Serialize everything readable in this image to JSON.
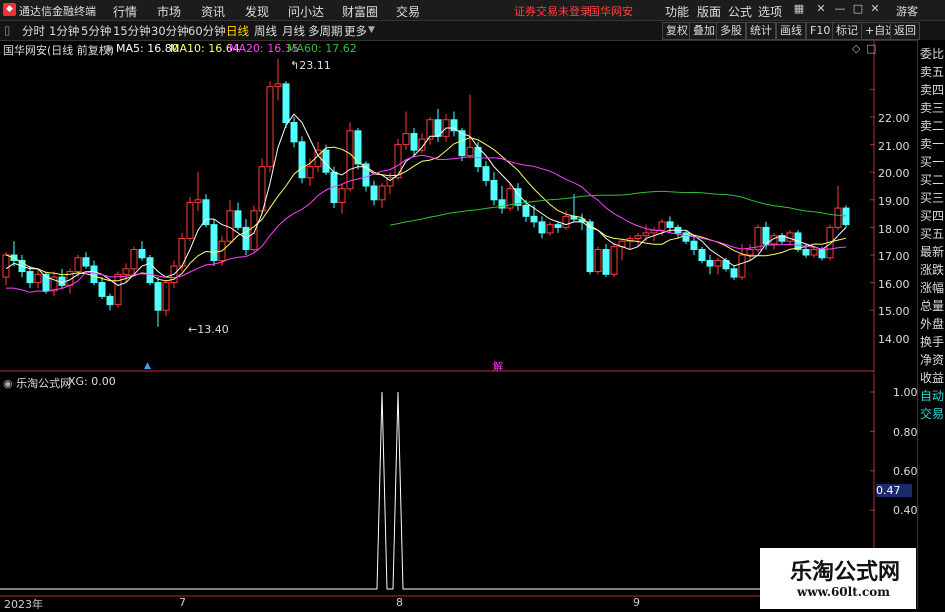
{
  "app": {
    "title": "通达信金融终端",
    "menus": [
      "行情",
      "市场",
      "资讯",
      "发现",
      "问小达",
      "财富圈",
      "交易"
    ],
    "login_status": "证券交易未登录",
    "stock_name": "国华网安",
    "right_menus": [
      "功能",
      "版面",
      "公式",
      "选项"
    ],
    "guest": "游客"
  },
  "toolbar": {
    "periods": [
      "分时",
      "1分钟",
      "5分钟",
      "15分钟",
      "30分钟",
      "60分钟",
      "日线",
      "周线",
      "月线",
      "多周期",
      "更多"
    ],
    "active": "日线",
    "right_buttons": [
      "复权",
      "叠加",
      "多股",
      "统计",
      "画线",
      "F10",
      "标记",
      "+自选",
      "返回"
    ]
  },
  "main_legend": {
    "title": "国华网安(日线 前复权)",
    "ma5": "MA5: 16.80",
    "ma10": "MA10: 16.64",
    "ma20": "MA20: 16.35",
    "ma60": "MA60: 17.62",
    "high_label": "23.11",
    "low_label": "13.40",
    "jie_marker": "解"
  },
  "sub_legend": {
    "title": "乐淘公式网",
    "xg": "XG: 0.00",
    "current": "0.47"
  },
  "price_axis": [
    "22.00",
    "21.00",
    "20.00",
    "19.00",
    "18.00",
    "17.00",
    "16.00",
    "15.00",
    "14.00"
  ],
  "indicator_axis": [
    "1.00",
    "0.80",
    "0.60",
    "0.40"
  ],
  "x_labels": [
    "2023年",
    "7",
    "8",
    "9"
  ],
  "sidebar": [
    "委比",
    "卖五",
    "卖四",
    "卖三",
    "卖二",
    "卖一",
    "买一",
    "买二",
    "买三",
    "买四",
    "买五",
    "最新",
    "涨跌",
    "涨幅",
    "总量",
    "外盘",
    "换手",
    "净资",
    "收益",
    "自动",
    "交易"
  ],
  "watermark": {
    "title": "乐淘公式网",
    "url": "www.60lt.com"
  },
  "colors": {
    "up": "#ff3b3b",
    "down": "#54ffff",
    "ma5": "#ffffff",
    "ma10": "#ffff66",
    "ma20": "#ff40ff",
    "ma60": "#30c030",
    "menu_red": "#ff4040"
  },
  "chart_data": {
    "type": "candlestick",
    "ylim": [
      13.0,
      23.5
    ],
    "candles": [
      [
        15.2,
        16.1,
        14.9,
        16.0
      ],
      [
        16.0,
        16.5,
        15.6,
        15.8
      ],
      [
        15.8,
        16.0,
        15.2,
        15.4
      ],
      [
        15.4,
        15.6,
        14.8,
        15.0
      ],
      [
        15.0,
        15.5,
        14.8,
        15.3
      ],
      [
        15.3,
        15.4,
        14.6,
        14.7
      ],
      [
        14.7,
        15.4,
        14.5,
        15.2
      ],
      [
        15.2,
        15.5,
        14.8,
        14.9
      ],
      [
        14.9,
        15.5,
        14.6,
        15.4
      ],
      [
        15.4,
        16.0,
        15.2,
        15.9
      ],
      [
        15.9,
        16.1,
        15.5,
        15.6
      ],
      [
        15.6,
        15.8,
        14.9,
        15.0
      ],
      [
        15.0,
        15.2,
        14.4,
        14.5
      ],
      [
        14.5,
        14.6,
        14.0,
        14.2
      ],
      [
        14.2,
        15.4,
        14.1,
        15.3
      ],
      [
        15.3,
        15.7,
        15.0,
        15.5
      ],
      [
        15.5,
        16.3,
        15.3,
        16.2
      ],
      [
        16.2,
        16.5,
        15.8,
        15.9
      ],
      [
        15.9,
        16.0,
        14.9,
        15.0
      ],
      [
        15.0,
        15.2,
        13.4,
        14.0
      ],
      [
        14.0,
        15.1,
        13.8,
        15.0
      ],
      [
        15.0,
        15.8,
        14.8,
        15.6
      ],
      [
        15.6,
        16.8,
        15.4,
        16.6
      ],
      [
        16.6,
        18.1,
        16.5,
        17.9
      ],
      [
        17.9,
        19.0,
        17.6,
        18.0
      ],
      [
        18.0,
        18.2,
        17.0,
        17.1
      ],
      [
        17.1,
        17.3,
        15.6,
        15.8
      ],
      [
        15.8,
        16.7,
        15.6,
        16.5
      ],
      [
        16.5,
        18.0,
        16.4,
        17.6
      ],
      [
        17.6,
        17.9,
        16.9,
        17.0
      ],
      [
        17.0,
        17.3,
        16.0,
        16.2
      ],
      [
        16.2,
        17.8,
        16.1,
        17.6
      ],
      [
        17.6,
        19.5,
        17.5,
        19.2
      ],
      [
        19.2,
        22.3,
        19.0,
        22.1
      ],
      [
        22.1,
        23.11,
        21.6,
        22.2
      ],
      [
        22.2,
        22.3,
        20.6,
        20.8
      ],
      [
        20.8,
        21.0,
        19.9,
        20.1
      ],
      [
        20.1,
        20.3,
        18.6,
        18.8
      ],
      [
        18.8,
        19.5,
        18.5,
        19.2
      ],
      [
        19.2,
        20.1,
        19.0,
        19.8
      ],
      [
        19.8,
        20.0,
        18.9,
        19.0
      ],
      [
        19.0,
        19.2,
        17.7,
        17.9
      ],
      [
        17.9,
        18.6,
        17.5,
        18.4
      ],
      [
        18.4,
        20.8,
        18.3,
        20.5
      ],
      [
        20.5,
        20.6,
        19.1,
        19.3
      ],
      [
        19.3,
        19.4,
        18.3,
        18.5
      ],
      [
        18.5,
        18.7,
        17.8,
        18.0
      ],
      [
        18.0,
        18.6,
        17.7,
        18.5
      ],
      [
        18.5,
        19.0,
        18.2,
        18.8
      ],
      [
        18.8,
        20.2,
        18.7,
        20.0
      ],
      [
        20.0,
        21.2,
        19.8,
        20.4
      ],
      [
        20.4,
        20.6,
        19.6,
        19.8
      ],
      [
        19.8,
        20.4,
        19.7,
        20.2
      ],
      [
        20.2,
        21.0,
        20.0,
        20.9
      ],
      [
        20.9,
        21.3,
        20.1,
        20.3
      ],
      [
        20.3,
        21.1,
        20.1,
        20.9
      ],
      [
        20.9,
        21.2,
        20.3,
        20.5
      ],
      [
        20.5,
        20.6,
        19.4,
        19.6
      ],
      [
        19.6,
        21.8,
        19.5,
        19.9
      ],
      [
        19.9,
        20.1,
        19.0,
        19.2
      ],
      [
        19.2,
        19.4,
        18.5,
        18.7
      ],
      [
        18.7,
        19.0,
        17.8,
        18.0
      ],
      [
        18.0,
        18.5,
        17.5,
        17.7
      ],
      [
        17.7,
        18.6,
        17.6,
        18.4
      ],
      [
        18.4,
        18.6,
        17.6,
        17.8
      ],
      [
        17.8,
        18.0,
        17.2,
        17.4
      ],
      [
        17.4,
        17.8,
        17.0,
        17.2
      ],
      [
        17.2,
        17.4,
        16.6,
        16.8
      ],
      [
        16.8,
        17.2,
        16.7,
        17.1
      ],
      [
        17.1,
        17.2,
        16.8,
        17.0
      ],
      [
        17.0,
        17.6,
        16.9,
        17.4
      ],
      [
        17.4,
        18.2,
        17.2,
        17.3
      ],
      [
        17.3,
        17.5,
        16.9,
        17.2
      ],
      [
        17.2,
        17.3,
        15.3,
        15.4
      ],
      [
        15.4,
        16.3,
        15.3,
        16.2
      ],
      [
        16.2,
        16.4,
        15.2,
        15.3
      ],
      [
        15.3,
        16.4,
        15.2,
        16.3
      ],
      [
        16.3,
        16.6,
        15.8,
        16.5
      ],
      [
        16.5,
        16.7,
        16.2,
        16.6
      ],
      [
        16.6,
        16.8,
        16.3,
        16.7
      ],
      [
        16.7,
        17.1,
        16.5,
        16.8
      ],
      [
        16.8,
        17.0,
        16.5,
        16.9
      ],
      [
        16.9,
        17.3,
        16.7,
        17.2
      ],
      [
        17.2,
        17.4,
        16.8,
        17.0
      ],
      [
        17.0,
        17.1,
        16.6,
        16.8
      ],
      [
        16.8,
        16.9,
        16.4,
        16.5
      ],
      [
        16.5,
        16.7,
        16.0,
        16.2
      ],
      [
        16.2,
        16.3,
        15.7,
        15.8
      ],
      [
        15.8,
        16.0,
        15.3,
        15.6
      ],
      [
        15.6,
        15.9,
        15.3,
        15.8
      ],
      [
        15.8,
        15.9,
        15.4,
        15.5
      ],
      [
        15.5,
        15.6,
        15.1,
        15.2
      ],
      [
        15.2,
        16.4,
        15.1,
        16.0
      ],
      [
        16.0,
        16.4,
        15.8,
        16.2
      ],
      [
        16.2,
        17.1,
        16.1,
        17.0
      ],
      [
        17.0,
        17.2,
        16.2,
        16.4
      ],
      [
        16.4,
        16.8,
        16.2,
        16.7
      ],
      [
        16.7,
        16.8,
        16.4,
        16.5
      ],
      [
        16.5,
        16.9,
        16.4,
        16.8
      ],
      [
        16.8,
        16.9,
        16.1,
        16.2
      ],
      [
        16.2,
        16.4,
        15.9,
        16.0
      ],
      [
        16.0,
        16.3,
        15.9,
        16.2
      ],
      [
        16.2,
        16.3,
        15.8,
        15.9
      ],
      [
        15.9,
        17.1,
        15.8,
        17.0
      ],
      [
        17.0,
        18.5,
        16.9,
        17.7
      ],
      [
        17.7,
        17.8,
        17.0,
        17.1
      ]
    ],
    "ma5": [
      15.5,
      15.7,
      15.6,
      15.5,
      15.5,
      15.2,
      15.1,
      15.0,
      15.1,
      15.3,
      15.4,
      15.4,
      15.3,
      15.1,
      14.9,
      15.0,
      15.3,
      15.6,
      15.7,
      15.4,
      15.2,
      15.3,
      15.6,
      16.2,
      16.9,
      17.3,
      17.3,
      17.1,
      17.0,
      16.8,
      16.6,
      16.8,
      17.5,
      18.6,
      19.9,
      20.7,
      21.1,
      20.8,
      20.2,
      19.6,
      19.3,
      19.0,
      18.9,
      19.1,
      19.2,
      19.2,
      19.0,
      18.9,
      18.7,
      18.9,
      19.4,
      19.6,
      19.9,
      20.3,
      20.3,
      20.6,
      20.6,
      20.4,
      20.3,
      19.9,
      19.6,
      19.2,
      18.9,
      18.6,
      18.2,
      17.9,
      17.7,
      17.5,
      17.3,
      17.2,
      17.1,
      17.2,
      17.2,
      17.0,
      16.9,
      16.6,
      16.4,
      16.3,
      16.2,
      16.3,
      16.6,
      16.7,
      16.8,
      16.9,
      16.9,
      16.9,
      16.7,
      16.5,
      16.2,
      16.0,
      15.8,
      15.6,
      15.7,
      15.8,
      16.0,
      16.4,
      16.6,
      16.7,
      16.6,
      16.5,
      16.4,
      16.3,
      16.2,
      16.4,
      16.7,
      17.0
    ],
    "ma60_start_index": 48,
    "indicator": {
      "type": "line",
      "ylim": [
        0,
        1.1
      ],
      "signals": [
        [
          47,
          1.0
        ],
        [
          49,
          1.0
        ]
      ]
    }
  }
}
